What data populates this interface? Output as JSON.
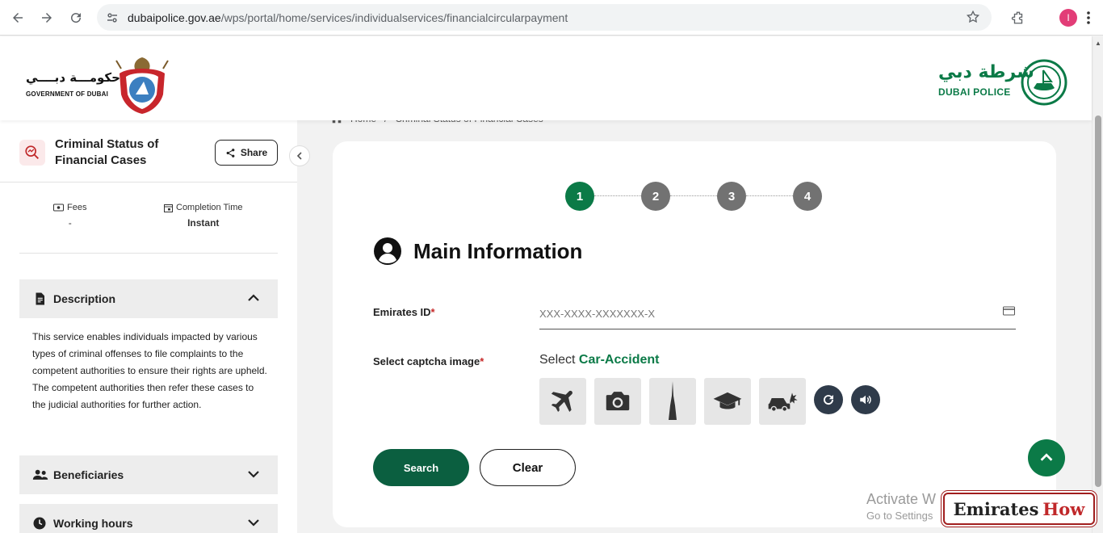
{
  "browser": {
    "url_host": "dubaipolice.gov.ae",
    "url_path": "/wps/portal/home/services/individualservices/financialcircularpayment",
    "profile_initial": "I"
  },
  "header": {
    "gov_ar": "حكومـــة دبــــي",
    "gov_en": "GOVERNMENT OF DUBAI",
    "dp_ar": "شرطة دبي",
    "dp_en": "DUBAI POLICE"
  },
  "breadcrumb": {
    "home": "Home",
    "separator": "/",
    "current": "Criminal Status of Financial Cases"
  },
  "sidebar": {
    "service_title": "Criminal Status of Financial Cases",
    "share_label": "Share",
    "fees_label": "Fees",
    "fees_value": "-",
    "time_label": "Completion Time",
    "time_value": "Instant",
    "description_label": "Description",
    "description_text": "This service enables individuals impacted by various types of criminal offenses to file complaints to the competent authorities to ensure their rights are upheld. The competent authorities then refer these cases to the judicial authorities for further action.",
    "beneficiaries_label": "Beneficiaries",
    "working_hours_label": "Working hours"
  },
  "form": {
    "steps": [
      "1",
      "2",
      "3",
      "4"
    ],
    "active_step": 1,
    "section_title": "Main Information",
    "emirates_id_label": "Emirates ID",
    "emirates_id_placeholder": "XXX-XXXX-XXXXXXX-X",
    "required_mark": "*",
    "captcha_label": "Select captcha image",
    "captcha_prompt_prefix": "Select",
    "captcha_target": "Car-Accident",
    "captcha_options": [
      "airplane-icon",
      "camera-icon",
      "burj-khalifa-icon",
      "graduation-cap-icon",
      "car-accident-icon"
    ],
    "search_label": "Search",
    "clear_label": "Clear"
  },
  "overlay": {
    "activate_line1": "Activate W",
    "activate_line2": "Go to Settings",
    "watermark_main": "Emirates",
    "watermark_accent": "How"
  },
  "colors": {
    "brand_green": "#0b7a47",
    "dark_green": "#0b5f40",
    "step_inactive": "#727272",
    "required": "#c62828"
  }
}
